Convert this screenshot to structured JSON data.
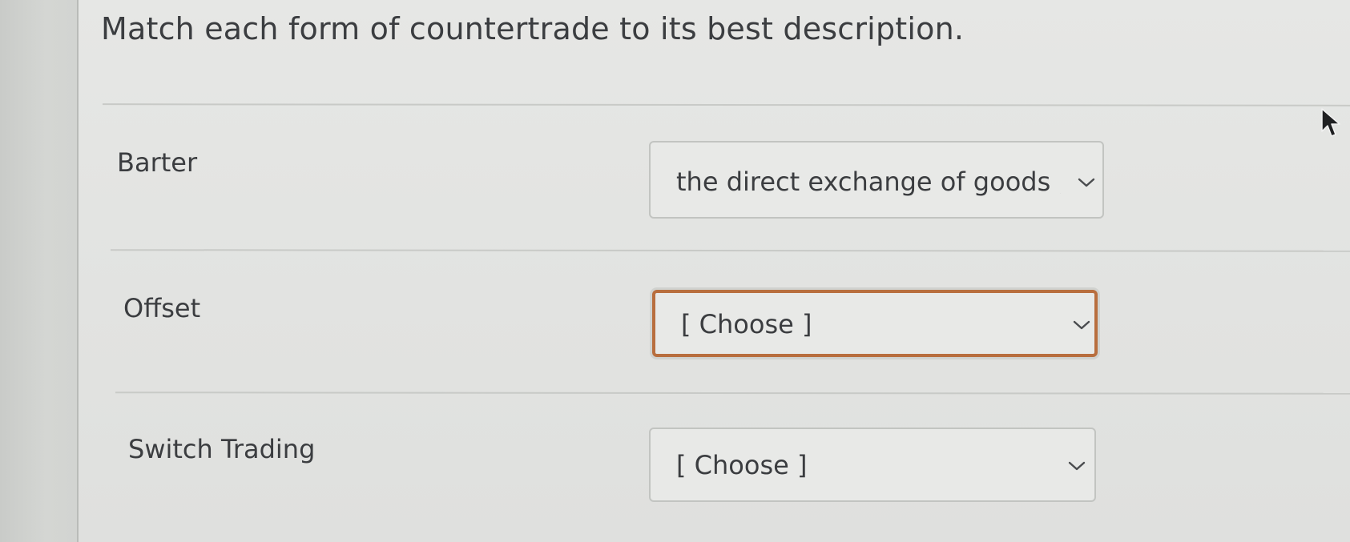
{
  "question": "Match each form of countertrade to its best description.",
  "rows": [
    {
      "label": "Barter",
      "selected": "the direct exchange of goods ;",
      "focused": false
    },
    {
      "label": "Offset",
      "selected": "[ Choose ]",
      "focused": true
    },
    {
      "label": "Switch Trading",
      "selected": "[ Choose ]",
      "focused": false
    }
  ],
  "icons": {
    "dropdown": "chevron-down-icon",
    "pointer": "mouse-cursor-icon"
  },
  "colors": {
    "focus_border": "#b86e3e",
    "text": "#3b3d40",
    "panel_bg": "#e4e5e3"
  }
}
